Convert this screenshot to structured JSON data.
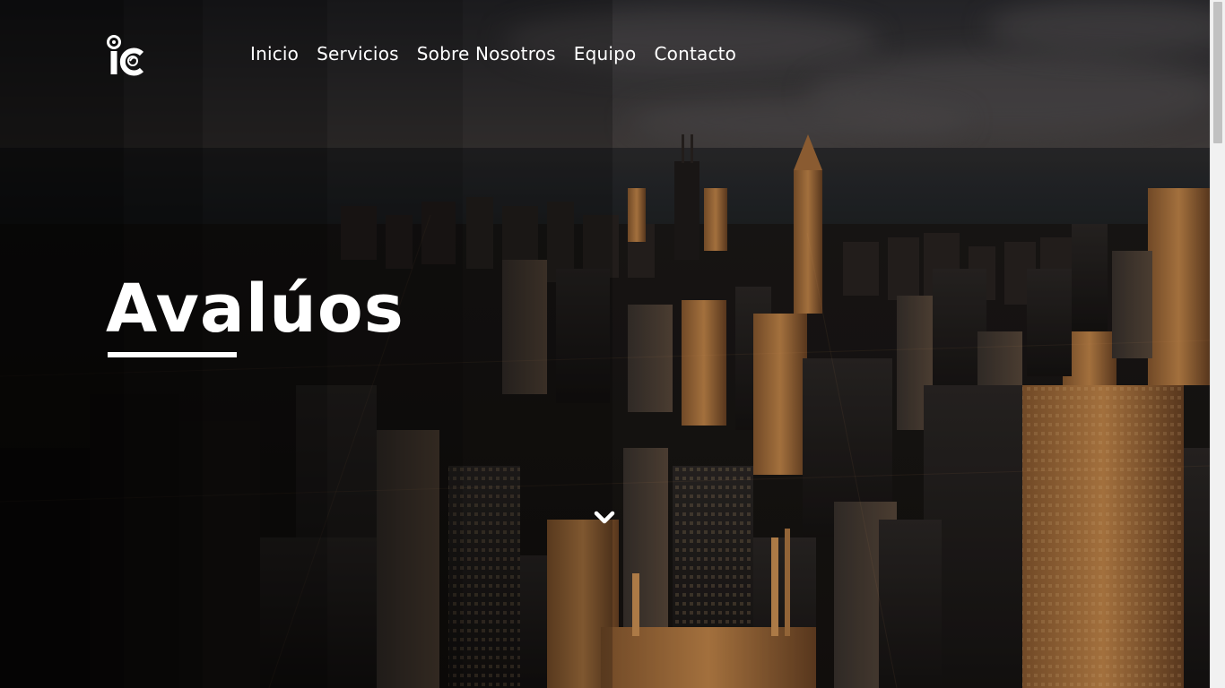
{
  "brand": {
    "logo_icon": "ic-location-pin-logo"
  },
  "nav": {
    "items": [
      {
        "label": "Inicio"
      },
      {
        "label": "Servicios"
      },
      {
        "label": "Sobre Nosotros"
      },
      {
        "label": "Equipo"
      },
      {
        "label": "Contacto"
      }
    ]
  },
  "hero": {
    "title": "Avalúos",
    "scroll_icon": "chevron-down-icon"
  },
  "colors": {
    "text": "#ffffff",
    "overlay": "#000000",
    "accent_warm": "#c88c4e"
  }
}
